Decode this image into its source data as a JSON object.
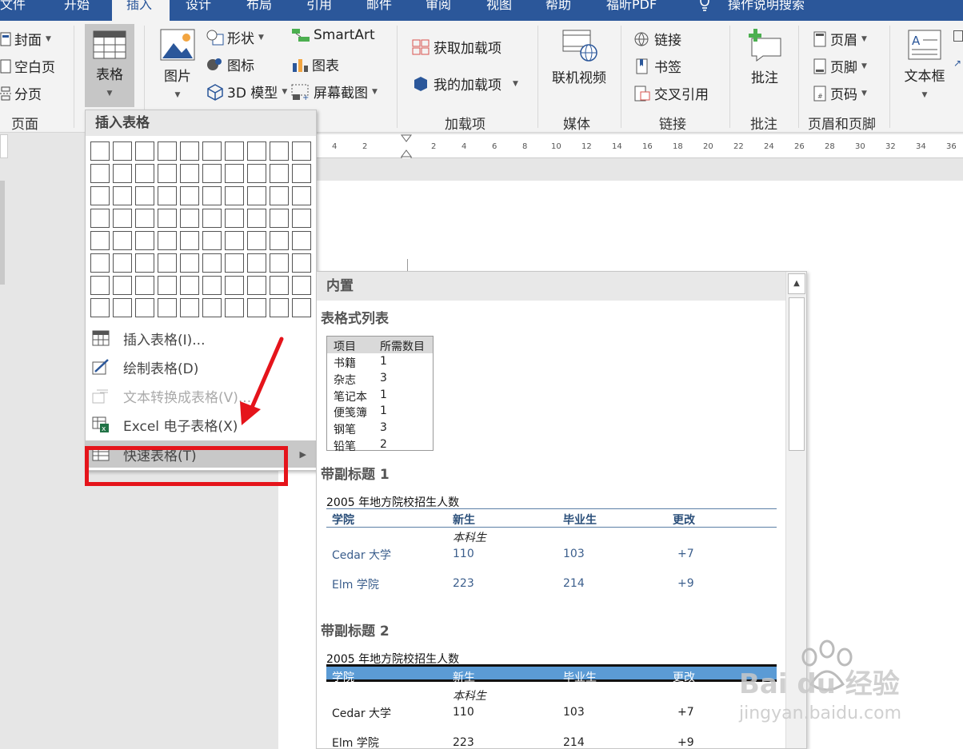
{
  "tabs": [
    {
      "label": "文件"
    },
    {
      "label": "开始"
    },
    {
      "label": "插入"
    },
    {
      "label": "设计"
    },
    {
      "label": "布局"
    },
    {
      "label": "引用"
    },
    {
      "label": "邮件"
    },
    {
      "label": "审阅"
    },
    {
      "label": "视图"
    },
    {
      "label": "帮助"
    },
    {
      "label": "福昕PDF"
    },
    {
      "label": "操作说明搜索"
    }
  ],
  "ribbon": {
    "pages": {
      "cover": "封面",
      "blank": "空白页",
      "break": "分页",
      "group": "页面"
    },
    "table": {
      "label": "表格"
    },
    "illustrations": {
      "picture": "图片",
      "shapes": "形状",
      "icons": "图标",
      "model3d": "3D 模型",
      "smartart": "SmartArt",
      "chart": "图表",
      "screenshot": "屏幕截图"
    },
    "addins": {
      "get": "获取加载项",
      "mine": "我的加载项",
      "group": "加载项"
    },
    "media": {
      "online_video": "联机视频",
      "group": "媒体"
    },
    "links": {
      "link": "链接",
      "bookmark": "书签",
      "crossref": "交叉引用",
      "group": "链接"
    },
    "comments": {
      "comment": "批注",
      "group": "批注"
    },
    "header_footer": {
      "header": "页眉",
      "footer": "页脚",
      "page_number": "页码",
      "group": "页眉和页脚"
    },
    "text": {
      "textbox": "文本框"
    }
  },
  "ruler": {
    "ticks": [
      "4",
      "2",
      "2",
      "4",
      "6",
      "8",
      "10",
      "12",
      "14",
      "16",
      "18",
      "20",
      "22",
      "24",
      "26",
      "28",
      "30",
      "32",
      "34",
      "36"
    ]
  },
  "table_menu": {
    "title": "插入表格",
    "grid": {
      "cols": 10,
      "rows": 8
    },
    "items": [
      {
        "label": "插入表格(I)...",
        "disabled": false
      },
      {
        "label": "绘制表格(D)",
        "disabled": false
      },
      {
        "label": "文本转换成表格(V)...",
        "disabled": true
      },
      {
        "label": "Excel 电子表格(X)",
        "disabled": false
      },
      {
        "label": "快速表格(T)",
        "disabled": false,
        "highlighted": true
      }
    ]
  },
  "gallery": {
    "header": "内置",
    "section1": {
      "title": "表格式列表",
      "col1": "项目",
      "col2": "所需数目",
      "rows": [
        {
          "item": "书籍",
          "qty": "1"
        },
        {
          "item": "杂志",
          "qty": "3"
        },
        {
          "item": "笔记本",
          "qty": "1"
        },
        {
          "item": "便笺簿",
          "qty": "1"
        },
        {
          "item": "钢笔",
          "qty": "3"
        },
        {
          "item": "铅笔",
          "qty": "2"
        }
      ]
    },
    "section2": {
      "title": "带副标题 1",
      "caption": "2005 年地方院校招生人数",
      "headers": [
        "学院",
        "新生",
        "毕业生",
        "更改"
      ],
      "subheading": "本科生",
      "rows": [
        [
          "Cedar 大学",
          "110",
          "103",
          "+7"
        ],
        [
          "Elm 学院",
          "223",
          "214",
          "+9"
        ]
      ]
    },
    "section3": {
      "title": "带副标题 2",
      "caption": "2005 年地方院校招生人数",
      "headers": [
        "学院",
        "新生",
        "毕业生",
        "更改"
      ],
      "subheading": "本科生",
      "rows": [
        [
          "Cedar 大学",
          "110",
          "103",
          "+7"
        ],
        [
          "Elm 学院",
          "223",
          "214",
          "+9"
        ]
      ]
    }
  },
  "watermark": {
    "brand": "Bai du 经验",
    "url": "jingyan.baidu.com"
  },
  "colors": {
    "tab_bar": "#2b579a",
    "highlight_box": "#e5141b",
    "table_header_band": "#5b9bd5"
  }
}
